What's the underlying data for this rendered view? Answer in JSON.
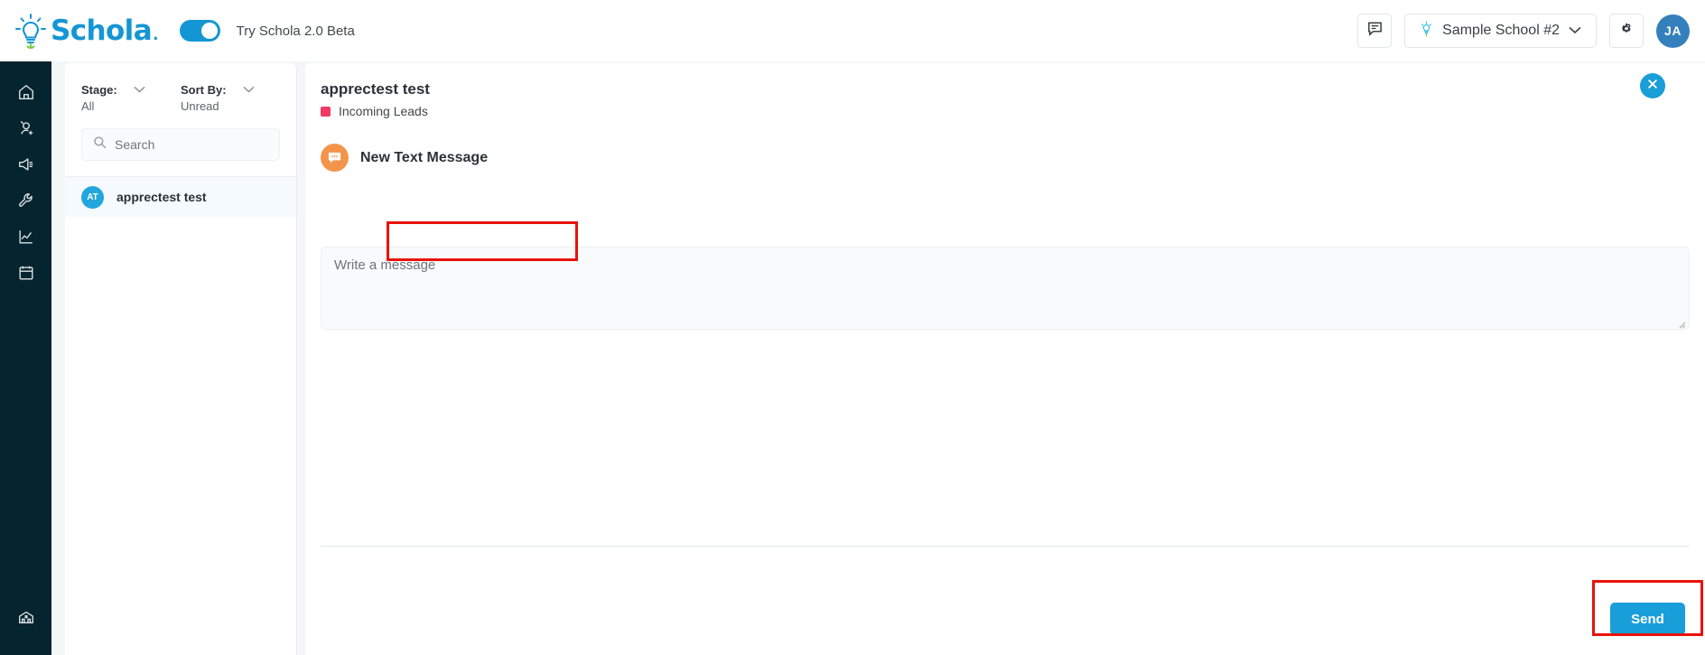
{
  "topbar": {
    "brand_name": "Schola",
    "brand_dot": ".",
    "beta_label": "Try Schola 2.0 Beta",
    "beta_toggle_on": true,
    "messages_icon": "chat-bubble-icon",
    "school_icon": "bulb-pin-icon",
    "school_name": "Sample School #2",
    "chevron_icon": "chevron-down-icon",
    "settings_icon": "gear-icon",
    "avatar_initials": "JA"
  },
  "leftnav": {
    "items": [
      {
        "name": "home",
        "icon": "home-icon"
      },
      {
        "name": "add-user",
        "icon": "person-add-icon"
      },
      {
        "name": "announcements",
        "icon": "megaphone-icon"
      },
      {
        "name": "tools",
        "icon": "wrench-icon"
      },
      {
        "name": "analytics",
        "icon": "line-chart-icon"
      },
      {
        "name": "calendar",
        "icon": "calendar-icon"
      }
    ],
    "bottom_item": {
      "name": "school",
      "icon": "school-building-icon"
    }
  },
  "list_panel": {
    "filters": [
      {
        "title": "Stage:",
        "value": "All"
      },
      {
        "title": "Sort By:",
        "value": "Unread"
      }
    ],
    "search": {
      "placeholder": "Search",
      "value": "",
      "icon": "search-icon"
    },
    "contacts": [
      {
        "initials": "AT",
        "name": "apprectest test",
        "selected": true
      }
    ]
  },
  "main_panel": {
    "lead_name": "apprectest test",
    "stage_label": "Incoming Leads",
    "stage_color": "#ef3b63",
    "close_icon": "close-icon",
    "compose": {
      "icon": "message-bubble-icon",
      "title": "New Text Message",
      "message_placeholder": "Write a message",
      "message_value": "",
      "resize_handle": "resize-grip-icon"
    },
    "send_label": "Send"
  },
  "annotations": {
    "highlight_color": "#e81309",
    "boxes": [
      {
        "name": "message-input-highlight"
      },
      {
        "name": "send-button-highlight"
      }
    ]
  }
}
